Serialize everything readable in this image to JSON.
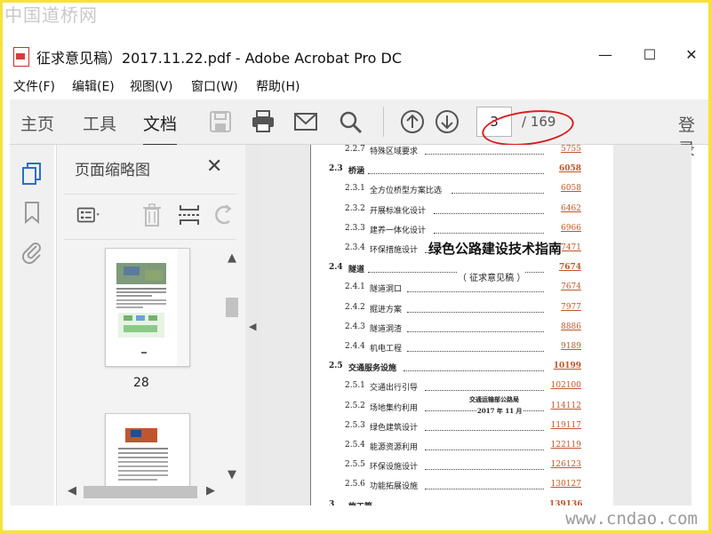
{
  "watermark_top": "中国道桥网",
  "watermark_bottom": "www.cndao.com",
  "window": {
    "title": "征求意见稿）2017.11.22.pdf - Adobe Acrobat Pro DC",
    "minimize": "—",
    "maximize": "☐",
    "close": "✕"
  },
  "menu": [
    "文件(F)",
    "编辑(E)",
    "视图(V)",
    "窗口(W)",
    "帮助(H)"
  ],
  "toolbar": {
    "tabs": [
      "主页",
      "工具",
      "文档"
    ],
    "active_tab": "文档",
    "page_current": "3",
    "page_total": "/ 169",
    "login": "登录",
    "icons": [
      "save-icon",
      "print-icon",
      "email-icon",
      "search-icon",
      "page-up-icon",
      "page-down-icon"
    ]
  },
  "side_icons": [
    "pages-icon",
    "bookmark-icon",
    "attachment-icon"
  ],
  "panel": {
    "title": "页面缩略图",
    "close": "✕",
    "thumbnail_label": "28",
    "tools": [
      "thumbnail-options-icon",
      "delete-icon",
      "insert-page-icon",
      "rotate-icon"
    ]
  },
  "document": {
    "overlay_title": "绿色公路建设技术指南",
    "overlay_subtitle": "（ 征求意见稿 ）",
    "overlay_org": "交通运输部公路局",
    "overlay_date": "2017 年 11 月",
    "toc": [
      {
        "num": "2.2.7",
        "text": "特殊区域要求",
        "page": "5755",
        "bold": false,
        "indent": true
      },
      {
        "num": "2.3",
        "text": "桥涵",
        "page": "6058",
        "bold": true,
        "indent": false
      },
      {
        "num": "2.3.1",
        "text": "全方位桥型方案比选",
        "page": "6058",
        "bold": false,
        "indent": true
      },
      {
        "num": "2.3.2",
        "text": "开展标准化设计",
        "page": "6462",
        "bold": false,
        "indent": true
      },
      {
        "num": "2.3.3",
        "text": "建养一体化设计",
        "page": "6966",
        "bold": false,
        "indent": true
      },
      {
        "num": "2.3.4",
        "text": "环保措施设计",
        "page": "7471",
        "bold": false,
        "indent": true
      },
      {
        "num": "2.4",
        "text": "隧道",
        "page": "7674",
        "bold": true,
        "indent": false
      },
      {
        "num": "2.4.1",
        "text": "隧道洞口",
        "page": "7674",
        "bold": false,
        "indent": true
      },
      {
        "num": "2.4.2",
        "text": "掘进方案",
        "page": "7977",
        "bold": false,
        "indent": true
      },
      {
        "num": "2.4.3",
        "text": "隧道洞渣",
        "page": "8886",
        "bold": false,
        "indent": true
      },
      {
        "num": "2.4.4",
        "text": "机电工程",
        "page": "9189",
        "bold": false,
        "indent": true
      },
      {
        "num": "2.5",
        "text": "交通服务设施",
        "page": "10199",
        "bold": true,
        "indent": false
      },
      {
        "num": "2.5.1",
        "text": "交通出行引导",
        "page": "102100",
        "bold": false,
        "indent": true
      },
      {
        "num": "2.5.2",
        "text": "场地集约利用",
        "page": "114112",
        "bold": false,
        "indent": true
      },
      {
        "num": "2.5.3",
        "text": "绿色建筑设计",
        "page": "119117",
        "bold": false,
        "indent": true
      },
      {
        "num": "2.5.4",
        "text": "能源资源利用",
        "page": "122119",
        "bold": false,
        "indent": true
      },
      {
        "num": "2.5.5",
        "text": "环保设施设计",
        "page": "126123",
        "bold": false,
        "indent": true
      },
      {
        "num": "2.5.6",
        "text": "功能拓展设施",
        "page": "130127",
        "bold": false,
        "indent": true
      },
      {
        "num": "3",
        "text": "施工篇",
        "page": "139136",
        "bold": true,
        "indent": false
      }
    ]
  },
  "colors": {
    "toolbar_bg": "#f0f0f0",
    "frame_border": "#f7e23a",
    "annotation_red": "#d82020",
    "link_orange": "#c0552b"
  }
}
